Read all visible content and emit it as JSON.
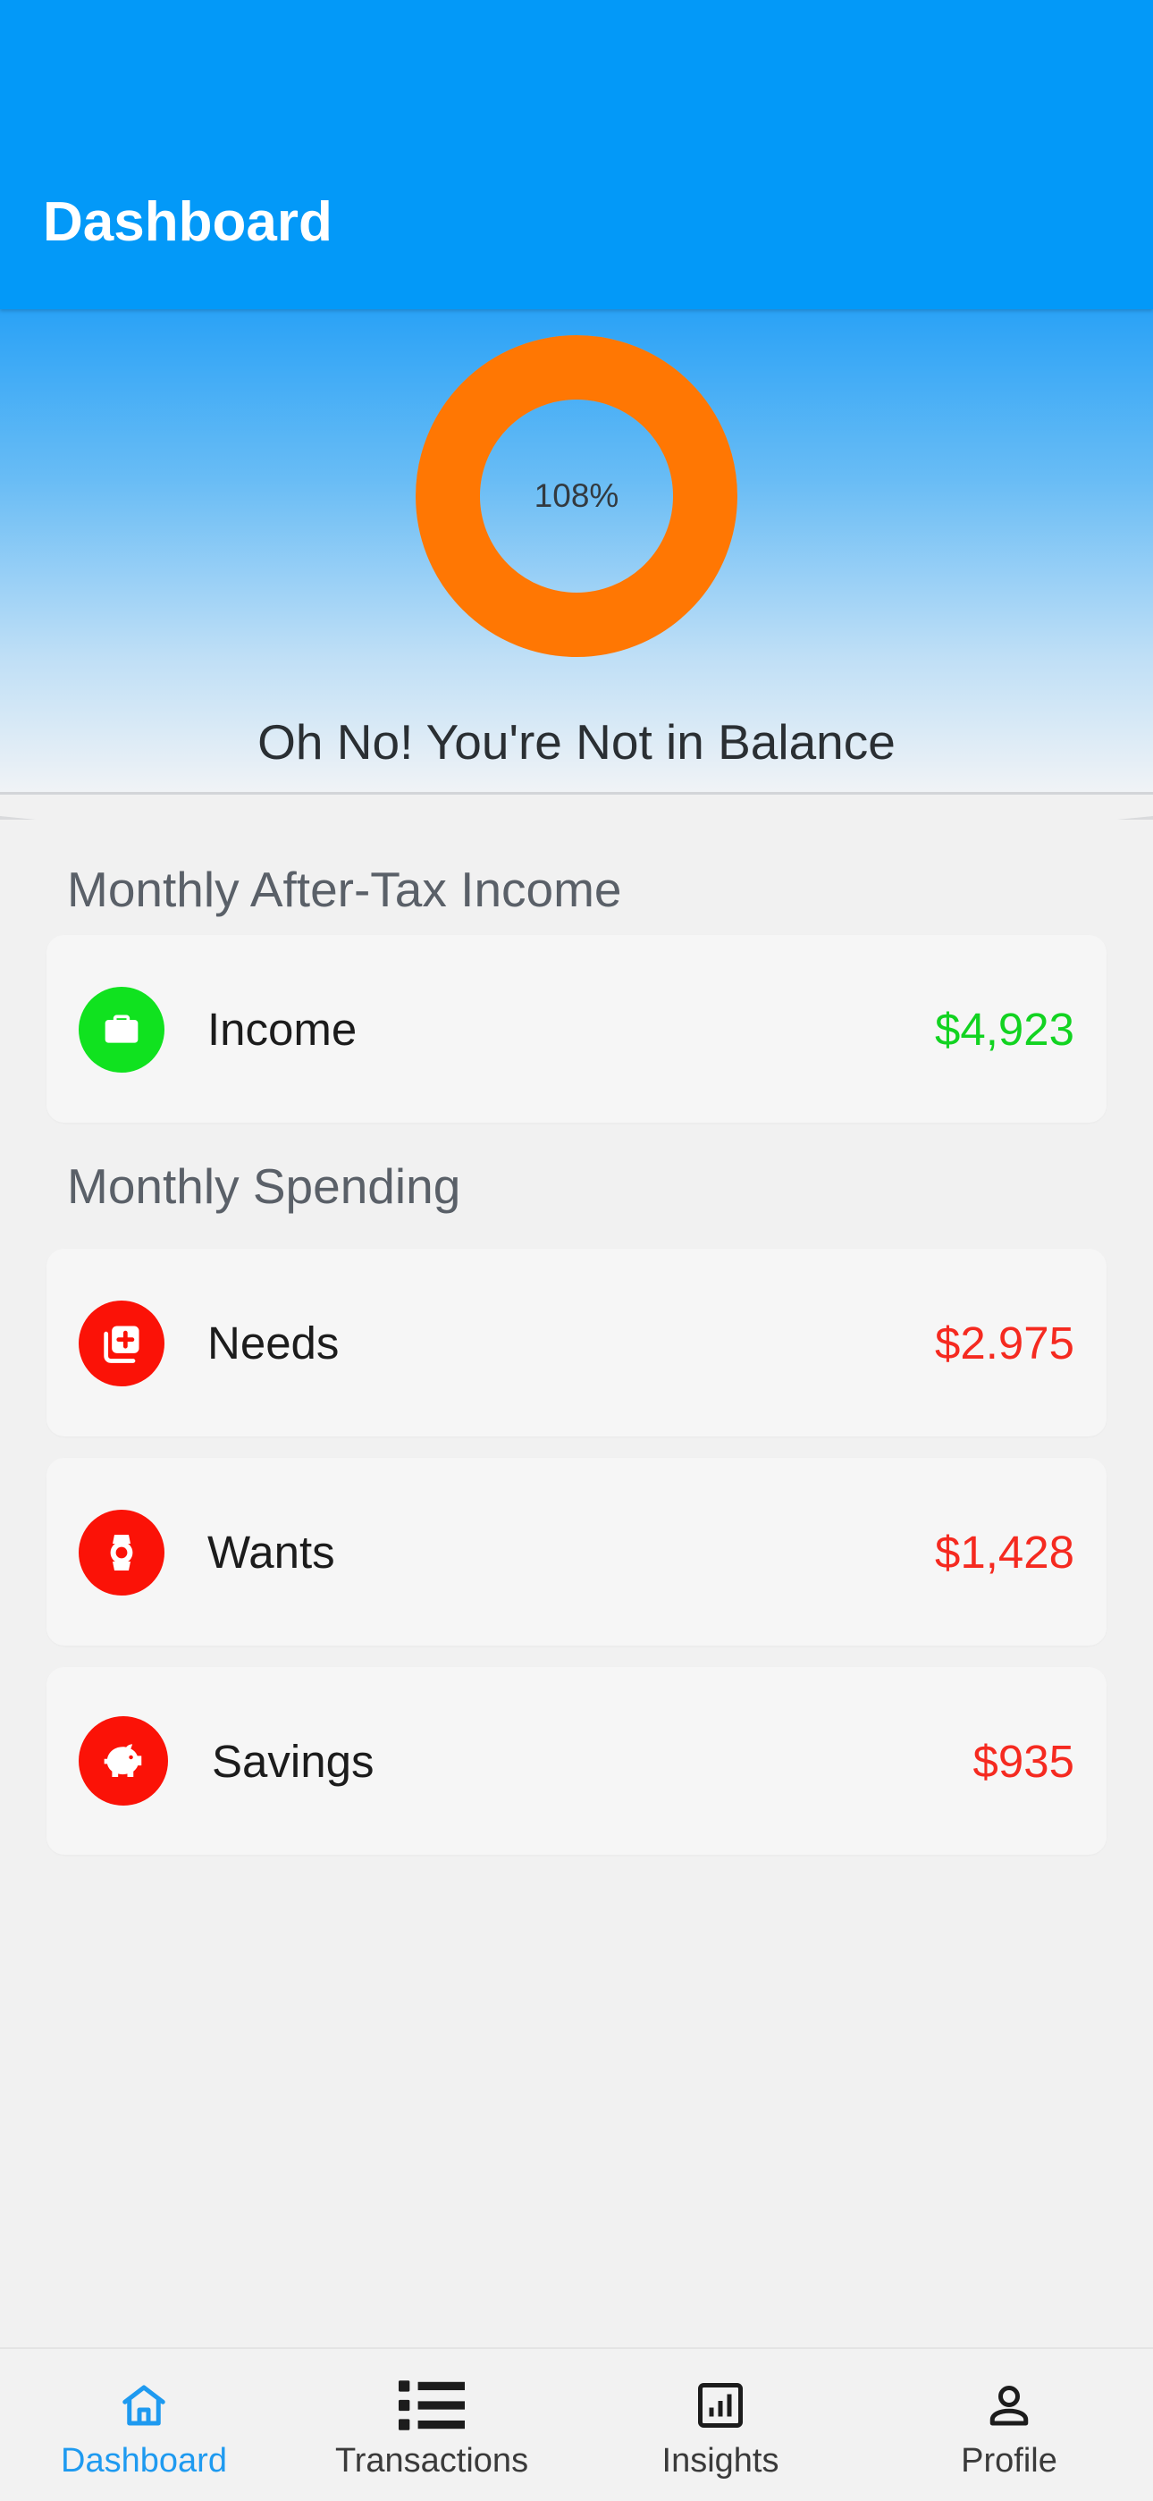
{
  "app_bar": {
    "title": "Dashboard"
  },
  "hero": {
    "donut_percent_label": "108%",
    "donut_fill_fraction": 1.0,
    "donut_color": "#ff7703",
    "message": "Oh No! You're Not in Balance"
  },
  "income_section": {
    "title": "Monthly After-Tax Income",
    "items": [
      {
        "label": "Income",
        "value": "$4,923",
        "icon": "briefcase-icon",
        "icon_bg": "#10e21f",
        "value_color": "#12d321"
      }
    ]
  },
  "spending_section": {
    "title": "Monthly Spending",
    "items": [
      {
        "label": "Needs",
        "value": "$2.975",
        "icon": "medical-add-icon",
        "icon_bg": "#fb1207",
        "value_color": "#f52a20"
      },
      {
        "label": "Wants",
        "value": "$1,428",
        "icon": "watch-icon",
        "icon_bg": "#fb1207",
        "value_color": "#f52a20"
      },
      {
        "label": "Savings",
        "value": "$935",
        "icon": "piggy-bank-icon",
        "icon_bg": "#fb1207",
        "value_color": "#f52a20"
      }
    ]
  },
  "bottom_nav": {
    "items": [
      {
        "label": "Dashboard",
        "icon": "home-icon",
        "active": true
      },
      {
        "label": "Transactions",
        "icon": "list-icon",
        "active": false
      },
      {
        "label": "Insights",
        "icon": "bar-chart-icon",
        "active": false
      },
      {
        "label": "Profile",
        "icon": "person-icon",
        "active": false
      }
    ],
    "active_color": "#1e9af0",
    "inactive_color": "#3a3a3a"
  }
}
